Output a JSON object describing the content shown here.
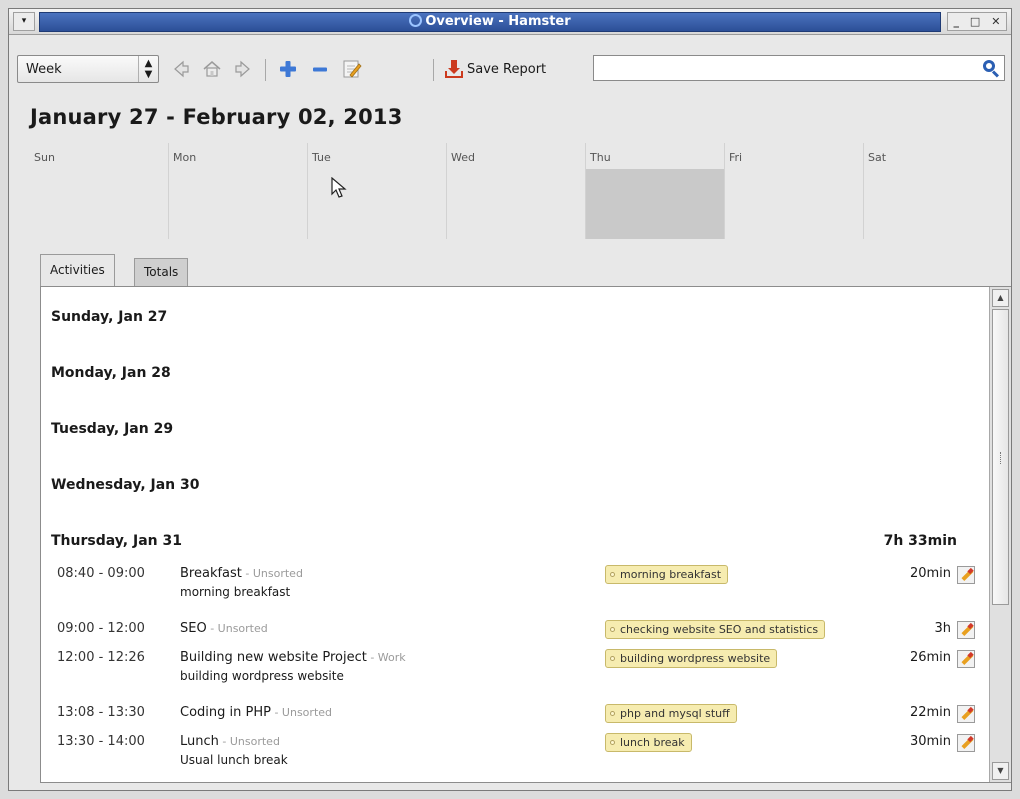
{
  "window": {
    "title": "Overview - Hamster",
    "menu_glyph": "▾",
    "minimize_glyph": "_",
    "maximize_glyph": "□",
    "close_glyph": "✕"
  },
  "toolbar": {
    "range_selector": "Week",
    "spin_up": "▲",
    "spin_down": "▼",
    "save_report_label": "Save Report",
    "search_value": "",
    "icons": [
      "previous-arrow-icon",
      "home-icon",
      "next-arrow-icon",
      "add-icon",
      "remove-icon",
      "edit-icon",
      "save-report-icon",
      "search-icon"
    ]
  },
  "overview": {
    "range_title": "January 27 - February 02, 2013",
    "weekdays": [
      "Sun",
      "Mon",
      "Tue",
      "Wed",
      "Thu",
      "Fri",
      "Sat"
    ],
    "highlighted_day": "Thu"
  },
  "tabs": [
    {
      "label": "Activities",
      "active": true
    },
    {
      "label": "Totals",
      "active": false
    }
  ],
  "activities": {
    "days": [
      {
        "label": "Sunday, Jan 27"
      },
      {
        "label": "Monday, Jan 28"
      },
      {
        "label": "Tuesday, Jan 29"
      },
      {
        "label": "Wednesday, Jan 30"
      },
      {
        "label": "Thursday, Jan 31",
        "total": "7h 33min"
      }
    ],
    "entries": [
      {
        "time": "08:40 - 09:00",
        "name": "Breakfast",
        "category": " - Unsorted",
        "description": "morning breakfast",
        "tag": "morning breakfast",
        "duration": "20min"
      },
      {
        "time": "09:00 - 12:00",
        "name": "SEO",
        "category": " - Unsorted",
        "description": "",
        "tag": "checking website SEO and statistics",
        "duration": "3h"
      },
      {
        "time": "12:00 - 12:26",
        "name": "Building new website Project",
        "category": " - Work",
        "description": "building wordpress website",
        "tag": "building wordpress website",
        "duration": "26min"
      },
      {
        "time": "13:08 - 13:30",
        "name": "Coding in PHP",
        "category": " - Unsorted",
        "description": "",
        "tag": "php and mysql stuff",
        "duration": "22min"
      },
      {
        "time": "13:30 - 14:00",
        "name": "Lunch",
        "category": " - Unsorted",
        "description": "Usual lunch break",
        "tag": "lunch break",
        "duration": "30min"
      }
    ]
  },
  "colors": {
    "titlebar_accent": "#2c4f97",
    "tag_background": "#f6ecb0",
    "today_highlight": "#c9c9c9"
  }
}
